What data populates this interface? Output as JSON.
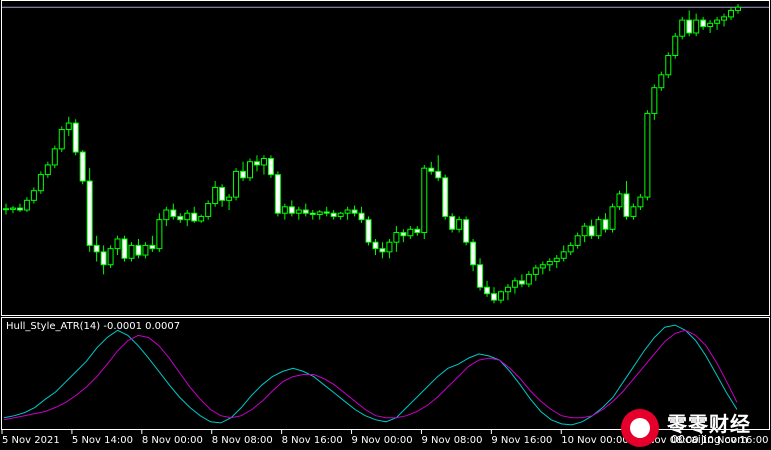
{
  "chart_data": [
    {
      "type": "candlestick",
      "up_color": "#ffffff",
      "down_color": "#ffffff",
      "wick_color": "#00ff00",
      "level_line": {
        "color": "#a0a0d0"
      },
      "candles": [
        [
          0.87,
          0.95,
          0.78,
          0.86
        ],
        [
          0.86,
          0.91,
          0.8,
          0.88
        ],
        [
          0.88,
          0.95,
          0.82,
          0.85
        ],
        [
          0.85,
          1.05,
          0.82,
          1.0
        ],
        [
          1.0,
          1.2,
          0.95,
          1.15
        ],
        [
          1.15,
          1.45,
          1.1,
          1.4
        ],
        [
          1.4,
          1.6,
          1.35,
          1.55
        ],
        [
          1.55,
          1.85,
          1.5,
          1.8
        ],
        [
          1.8,
          2.15,
          1.75,
          2.1
        ],
        [
          2.1,
          2.3,
          2.0,
          2.2
        ],
        [
          2.2,
          2.26,
          1.7,
          1.75
        ],
        [
          1.75,
          1.78,
          1.25,
          1.3
        ],
        [
          1.3,
          1.5,
          0.2,
          0.3
        ],
        [
          0.3,
          0.45,
          0.05,
          0.2
        ],
        [
          0.2,
          0.3,
          -0.15,
          0.0
        ],
        [
          0.0,
          0.3,
          -0.05,
          0.25
        ],
        [
          0.25,
          0.45,
          0.15,
          0.4
        ],
        [
          0.4,
          0.45,
          0.05,
          0.1
        ],
        [
          0.1,
          0.35,
          0.05,
          0.3
        ],
        [
          0.3,
          0.4,
          0.1,
          0.15
        ],
        [
          0.15,
          0.35,
          0.1,
          0.3
        ],
        [
          0.3,
          0.45,
          0.2,
          0.25
        ],
        [
          0.25,
          0.8,
          0.2,
          0.7
        ],
        [
          0.7,
          0.9,
          0.6,
          0.85
        ],
        [
          0.85,
          0.95,
          0.7,
          0.75
        ],
        [
          0.75,
          0.8,
          0.65,
          0.7
        ],
        [
          0.7,
          0.85,
          0.6,
          0.8
        ],
        [
          0.8,
          0.9,
          0.65,
          0.68
        ],
        [
          0.68,
          0.78,
          0.65,
          0.75
        ],
        [
          0.75,
          1.0,
          0.7,
          0.95
        ],
        [
          0.95,
          1.3,
          0.9,
          1.2
        ],
        [
          1.2,
          1.25,
          0.9,
          1.0
        ],
        [
          1.0,
          1.1,
          0.85,
          1.05
        ],
        [
          1.05,
          1.5,
          1.0,
          1.45
        ],
        [
          1.45,
          1.6,
          1.3,
          1.35
        ],
        [
          1.35,
          1.65,
          1.3,
          1.6
        ],
        [
          1.6,
          1.7,
          1.45,
          1.55
        ],
        [
          1.55,
          1.7,
          1.4,
          1.65
        ],
        [
          1.65,
          1.7,
          1.35,
          1.4
        ],
        [
          1.4,
          1.45,
          0.75,
          0.8
        ],
        [
          0.8,
          0.95,
          0.7,
          0.9
        ],
        [
          0.9,
          1.0,
          0.75,
          0.8
        ],
        [
          0.8,
          0.9,
          0.7,
          0.85
        ],
        [
          0.85,
          0.95,
          0.75,
          0.8
        ],
        [
          0.8,
          0.85,
          0.7,
          0.78
        ],
        [
          0.78,
          0.85,
          0.7,
          0.82
        ],
        [
          0.82,
          0.9,
          0.75,
          0.8
        ],
        [
          0.8,
          0.85,
          0.7,
          0.75
        ],
        [
          0.75,
          0.82,
          0.7,
          0.8
        ],
        [
          0.8,
          0.9,
          0.7,
          0.85
        ],
        [
          0.85,
          0.92,
          0.75,
          0.8
        ],
        [
          0.8,
          0.9,
          0.65,
          0.7
        ],
        [
          0.7,
          0.75,
          0.3,
          0.35
        ],
        [
          0.35,
          0.4,
          0.15,
          0.25
        ],
        [
          0.25,
          0.35,
          0.1,
          0.2
        ],
        [
          0.2,
          0.4,
          0.1,
          0.35
        ],
        [
          0.35,
          0.6,
          0.2,
          0.5
        ],
        [
          0.5,
          0.55,
          0.35,
          0.45
        ],
        [
          0.45,
          0.6,
          0.4,
          0.55
        ],
        [
          0.55,
          0.6,
          0.45,
          0.5
        ],
        [
          0.5,
          1.55,
          0.4,
          1.5
        ],
        [
          1.5,
          1.6,
          1.4,
          1.45
        ],
        [
          1.45,
          1.7,
          1.3,
          1.35
        ],
        [
          1.35,
          1.4,
          0.7,
          0.75
        ],
        [
          0.75,
          0.8,
          0.5,
          0.55
        ],
        [
          0.55,
          0.75,
          0.5,
          0.7
        ],
        [
          0.7,
          0.75,
          0.3,
          0.35
        ],
        [
          0.35,
          0.4,
          -0.1,
          0.0
        ],
        [
          0.0,
          0.1,
          -0.4,
          -0.35
        ],
        [
          -0.35,
          -0.25,
          -0.5,
          -0.45
        ],
        [
          -0.45,
          -0.35,
          -0.6,
          -0.55
        ],
        [
          -0.55,
          -0.4,
          -0.6,
          -0.42
        ],
        [
          -0.42,
          -0.3,
          -0.55,
          -0.35
        ],
        [
          -0.35,
          -0.2,
          -0.45,
          -0.25
        ],
        [
          -0.25,
          -0.15,
          -0.35,
          -0.3
        ],
        [
          -0.3,
          -0.1,
          -0.35,
          -0.15
        ],
        [
          -0.15,
          0.0,
          -0.25,
          -0.05
        ],
        [
          -0.05,
          0.05,
          -0.15,
          0.0
        ],
        [
          0.0,
          0.1,
          -0.1,
          0.05
        ],
        [
          0.05,
          0.15,
          -0.05,
          0.1
        ],
        [
          0.1,
          0.3,
          0.05,
          0.2
        ],
        [
          0.2,
          0.35,
          0.15,
          0.3
        ],
        [
          0.3,
          0.5,
          0.25,
          0.45
        ],
        [
          0.45,
          0.65,
          0.35,
          0.6
        ],
        [
          0.6,
          0.7,
          0.4,
          0.45
        ],
        [
          0.45,
          0.75,
          0.4,
          0.7
        ],
        [
          0.7,
          0.8,
          0.5,
          0.55
        ],
        [
          0.55,
          0.95,
          0.5,
          0.9
        ],
        [
          0.9,
          1.15,
          0.85,
          1.1
        ],
        [
          1.1,
          1.3,
          0.7,
          0.75
        ],
        [
          0.75,
          0.95,
          0.7,
          0.9
        ],
        [
          0.9,
          1.1,
          0.85,
          1.05
        ],
        [
          1.05,
          2.4,
          1.0,
          2.35
        ],
        [
          2.35,
          2.8,
          2.25,
          2.75
        ],
        [
          2.75,
          3.0,
          2.7,
          2.95
        ],
        [
          2.95,
          3.3,
          2.9,
          3.25
        ],
        [
          3.25,
          3.6,
          3.2,
          3.55
        ],
        [
          3.55,
          3.85,
          3.5,
          3.8
        ],
        [
          3.8,
          3.95,
          3.55,
          3.6
        ],
        [
          3.6,
          3.9,
          3.55,
          3.8
        ],
        [
          3.8,
          3.85,
          3.65,
          3.7
        ],
        [
          3.7,
          3.8,
          3.6,
          3.75
        ],
        [
          3.75,
          3.85,
          3.65,
          3.8
        ],
        [
          3.8,
          3.9,
          3.7,
          3.85
        ],
        [
          3.85,
          4.0,
          3.8,
          3.95
        ],
        [
          3.95,
          4.05,
          3.9,
          4.0
        ]
      ],
      "ylim": [
        -0.75,
        4.05
      ],
      "level": 4.0
    },
    {
      "type": "line",
      "title": "Hull_Style_ATR(14) -0.0001 0.0007",
      "series": [
        {
          "color": "#00c8c8",
          "values": [
            0.1,
            0.12,
            0.15,
            0.2,
            0.28,
            0.35,
            0.45,
            0.55,
            0.65,
            0.78,
            0.88,
            0.95,
            0.9,
            0.8,
            0.68,
            0.55,
            0.42,
            0.3,
            0.2,
            0.12,
            0.06,
            0.05,
            0.1,
            0.2,
            0.32,
            0.42,
            0.5,
            0.55,
            0.58,
            0.55,
            0.5,
            0.42,
            0.34,
            0.26,
            0.18,
            0.12,
            0.08,
            0.06,
            0.1,
            0.2,
            0.3,
            0.4,
            0.5,
            0.58,
            0.62,
            0.68,
            0.72,
            0.7,
            0.66,
            0.55,
            0.42,
            0.28,
            0.16,
            0.08,
            0.04,
            0.03,
            0.06,
            0.12,
            0.2,
            0.3,
            0.45,
            0.6,
            0.75,
            0.88,
            0.98,
            1.0,
            0.95,
            0.85,
            0.7,
            0.52,
            0.34,
            0.18
          ]
        },
        {
          "color": "#c800c8",
          "values": [
            0.08,
            0.1,
            0.12,
            0.14,
            0.16,
            0.2,
            0.25,
            0.32,
            0.4,
            0.5,
            0.62,
            0.75,
            0.85,
            0.9,
            0.88,
            0.8,
            0.68,
            0.54,
            0.4,
            0.28,
            0.18,
            0.12,
            0.1,
            0.12,
            0.18,
            0.26,
            0.36,
            0.45,
            0.5,
            0.52,
            0.52,
            0.48,
            0.42,
            0.34,
            0.26,
            0.18,
            0.12,
            0.1,
            0.1,
            0.12,
            0.16,
            0.22,
            0.3,
            0.4,
            0.5,
            0.6,
            0.66,
            0.68,
            0.66,
            0.58,
            0.48,
            0.36,
            0.26,
            0.18,
            0.12,
            0.1,
            0.1,
            0.12,
            0.18,
            0.26,
            0.36,
            0.48,
            0.6,
            0.72,
            0.84,
            0.92,
            0.95,
            0.9,
            0.8,
            0.64,
            0.45,
            0.25
          ]
        }
      ],
      "ylim": [
        0,
        1.05
      ]
    }
  ],
  "xaxis": {
    "ticks": [
      "5 Nov 2021",
      "5 Nov 14:00",
      "8 Nov 00:00",
      "8 Nov 08:00",
      "8 Nov 16:00",
      "9 Nov 00:00",
      "9 Nov 08:00",
      "9 Nov 16:00",
      "10 Nov 00:00",
      "10 Nov 08:00",
      "10 Nov 16:00"
    ]
  },
  "watermark": {
    "brand": "零零财经",
    "site": "00caijing.com"
  },
  "colors": {
    "background": "#000000",
    "grid_border": "#ffffff",
    "text": "#ffffff"
  }
}
